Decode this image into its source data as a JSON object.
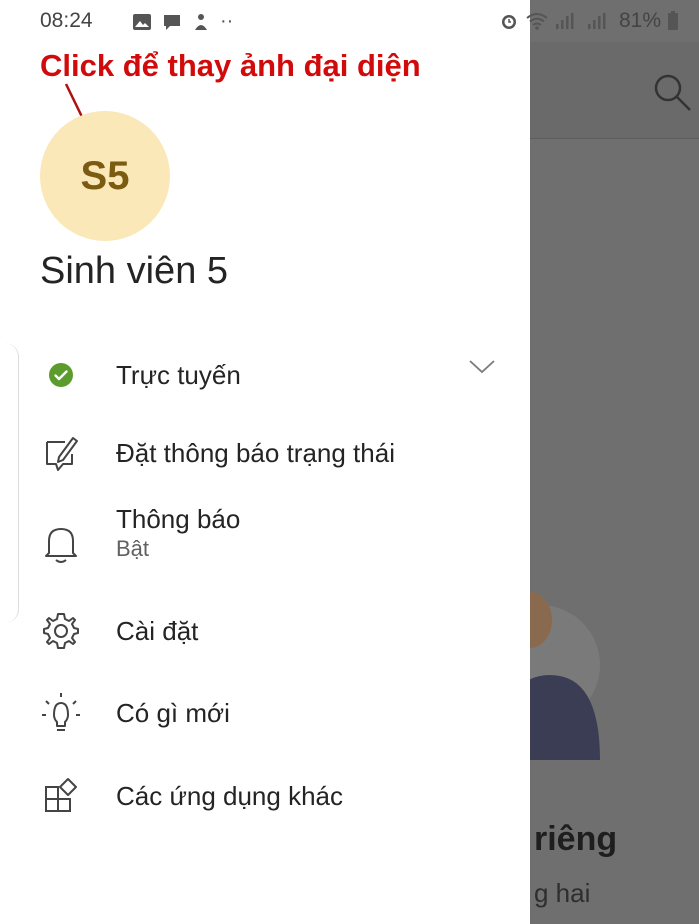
{
  "status_bar": {
    "time": "08:24",
    "battery": "81%"
  },
  "annotation": {
    "text": "Click để thay ảnh đại diện",
    "color": "#d10b0b"
  },
  "profile": {
    "initials": "S5",
    "name": "Sinh viên 5",
    "avatar_color": "#fbe8b8"
  },
  "menu": {
    "presence": {
      "label": "Trực tuyến",
      "icon": "green-check-circle-icon",
      "status_color": "#5b9c2d"
    },
    "set_status": {
      "label": "Đặt thông báo trạng thái",
      "icon": "edit-message-icon"
    },
    "notifications": {
      "label": "Thông báo",
      "sublabel": "Bật",
      "icon": "bell-icon"
    },
    "settings": {
      "label": "Cài đặt",
      "icon": "gear-icon"
    },
    "whats_new": {
      "label": "Có gì mới",
      "icon": "lightbulb-icon"
    },
    "more_apps": {
      "label": "Các ứng dụng khác",
      "icon": "apps-icon"
    }
  },
  "background": {
    "text1": "riêng",
    "text2": "g hai"
  }
}
